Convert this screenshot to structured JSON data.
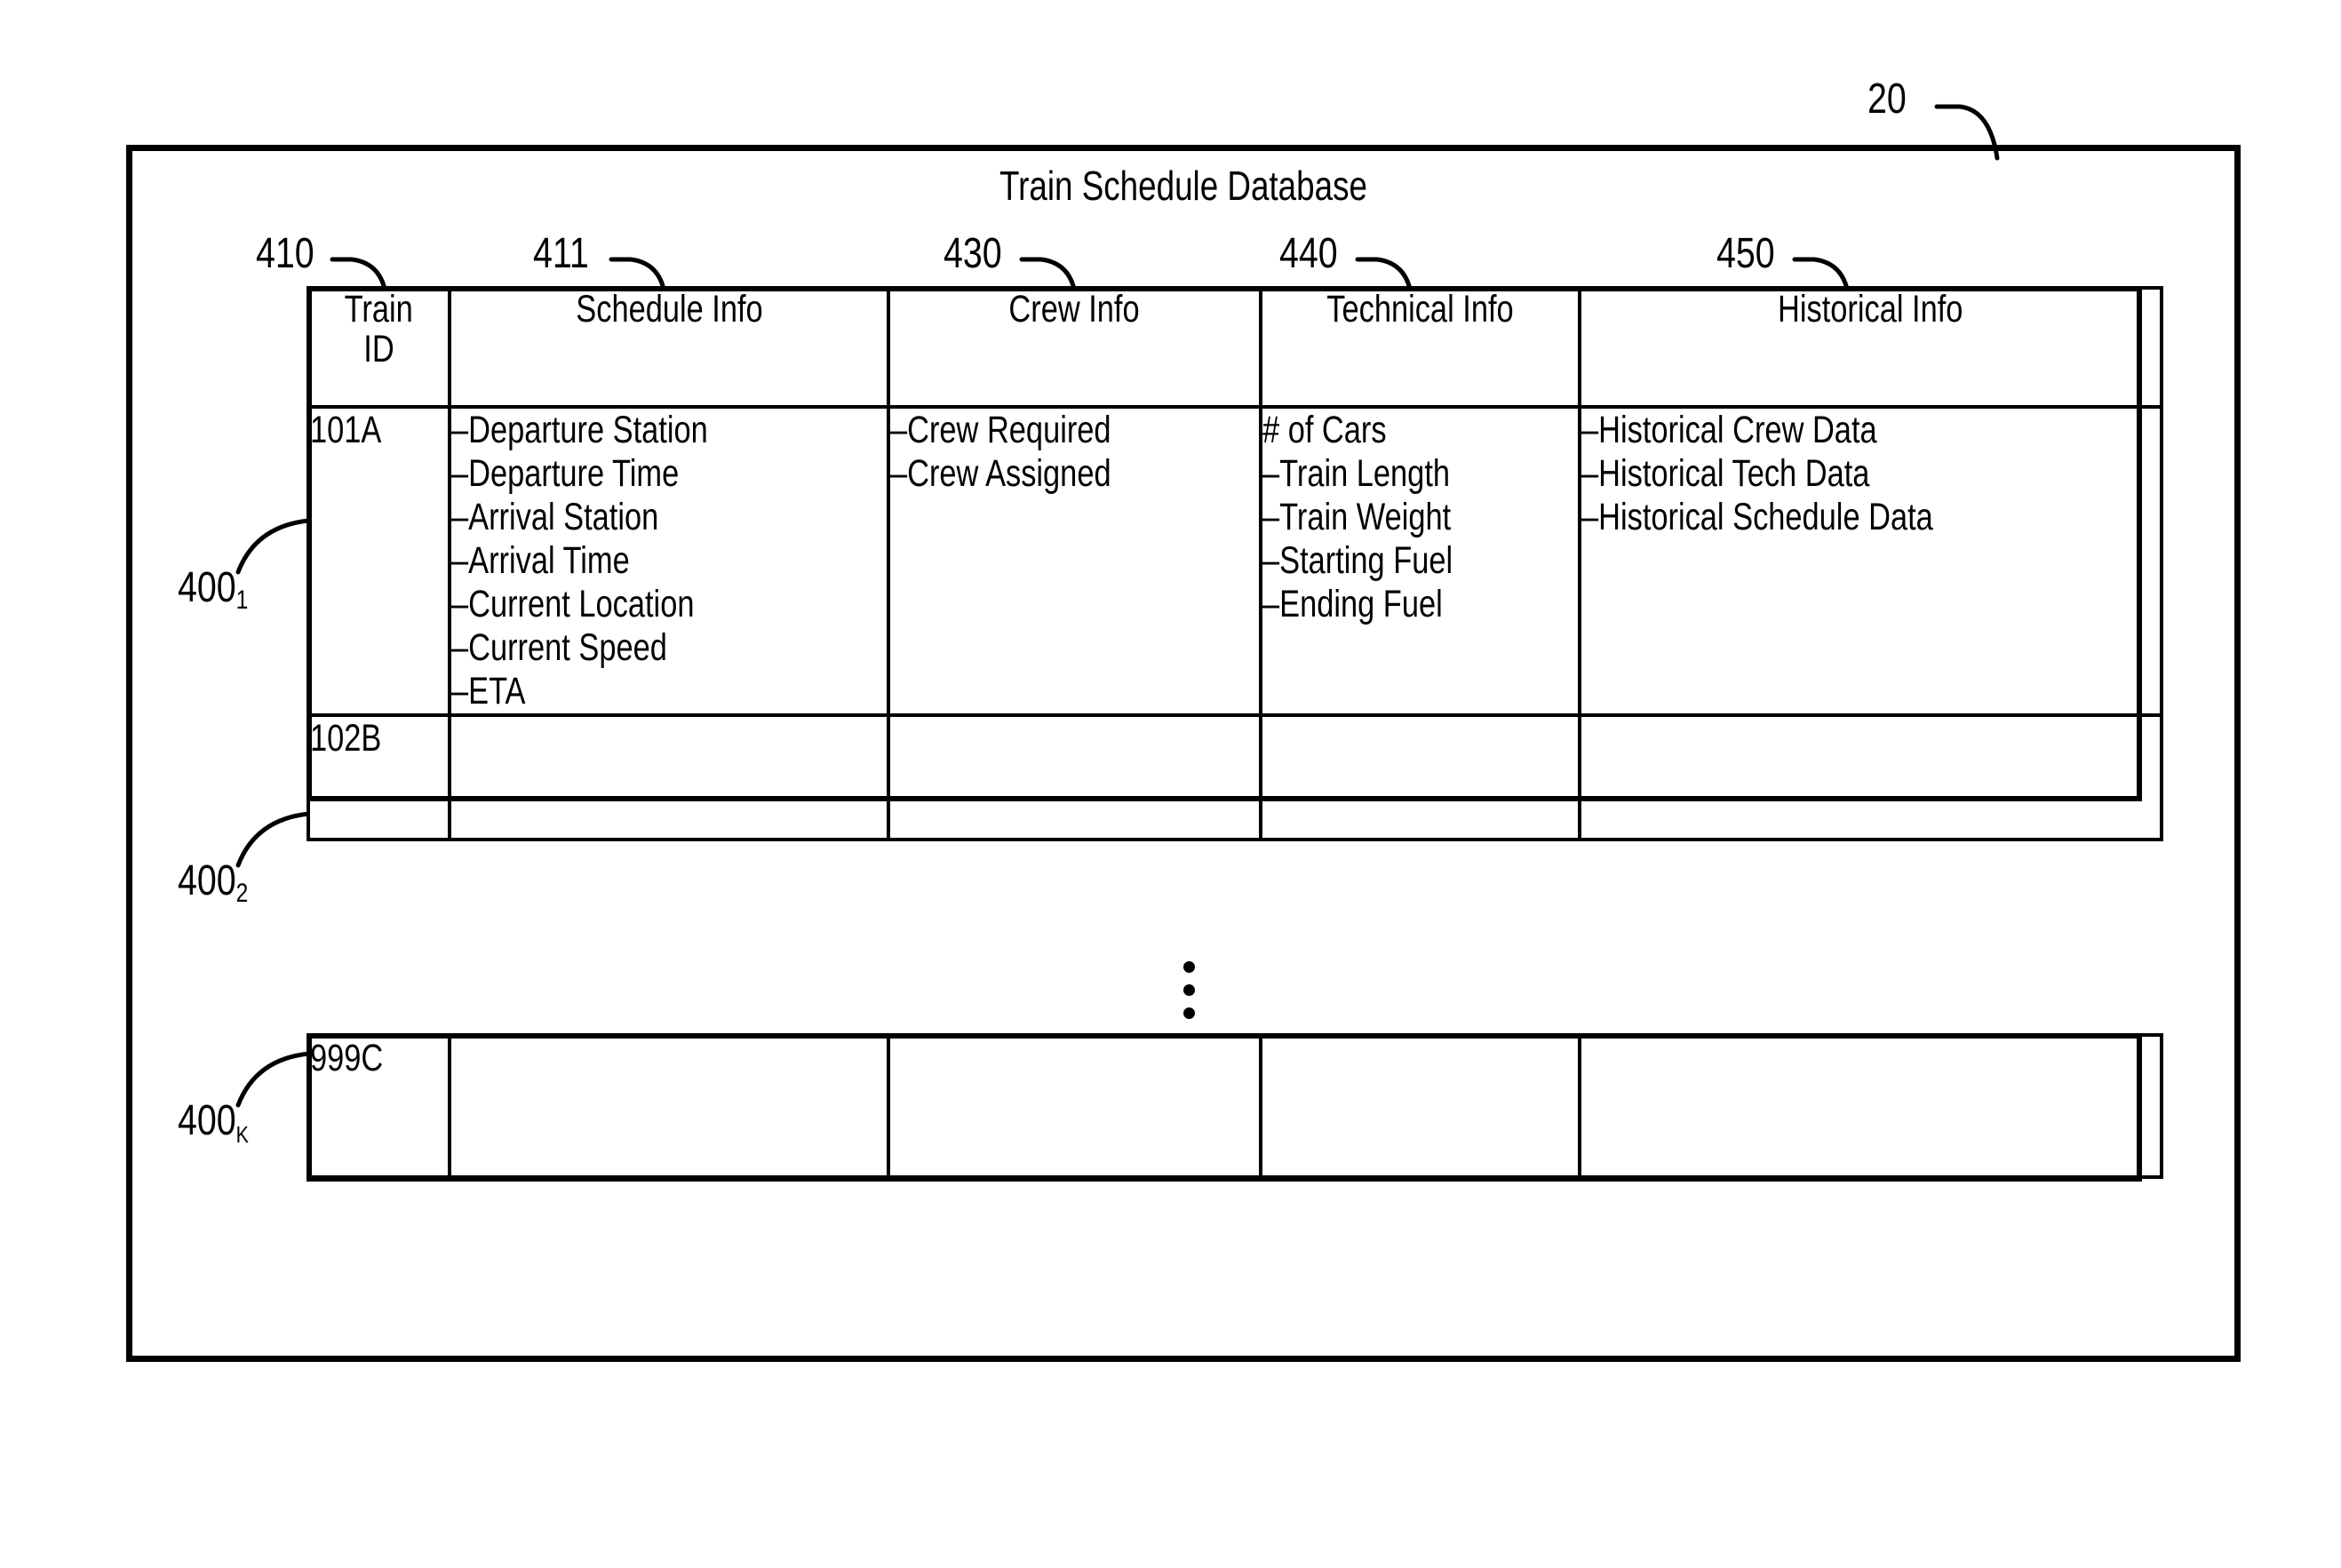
{
  "figure": {
    "outer_ref": "20",
    "title": "Train Schedule Database"
  },
  "column_refs": {
    "train_id": "410",
    "schedule_info": "411",
    "crew_info": "430",
    "technical_info": "440",
    "historical_info": "450"
  },
  "row_refs": {
    "row1_base": "400",
    "row1_sub": "1",
    "row2_base": "400",
    "row2_sub": "2",
    "row3_base": "400",
    "row3_sub": "K"
  },
  "table": {
    "headers": {
      "train_id_line1": "Train",
      "train_id_line2": "ID",
      "schedule_info": "Schedule Info",
      "crew_info": "Crew Info",
      "technical_info": "Technical Info",
      "historical_info": "Historical Info"
    },
    "rows": [
      {
        "train_id": "101A",
        "schedule_info": [
          "–Departure Station",
          "–Departure Time",
          "–Arrival Station",
          "–Arrival Time",
          "–Current Location",
          "–Current Speed",
          "–ETA"
        ],
        "crew_info": [
          "–Crew Required",
          "–Crew Assigned"
        ],
        "technical_info": [
          "# of Cars",
          "–Train Length",
          "–Train Weight",
          "–Starting Fuel",
          "–Ending Fuel"
        ],
        "historical_info": [
          "–Historical Crew Data",
          "–Historical Tech Data",
          "–Historical Schedule Data"
        ]
      },
      {
        "train_id": "102B",
        "schedule_info": [],
        "crew_info": [],
        "technical_info": [],
        "historical_info": []
      },
      {
        "train_id": "999C",
        "schedule_info": [],
        "crew_info": [],
        "technical_info": [],
        "historical_info": []
      }
    ]
  },
  "ellipsis": {
    "glyph": "vertical-ellipsis",
    "dots": 3
  },
  "colors": {
    "line": "#000000",
    "background": "#ffffff"
  }
}
